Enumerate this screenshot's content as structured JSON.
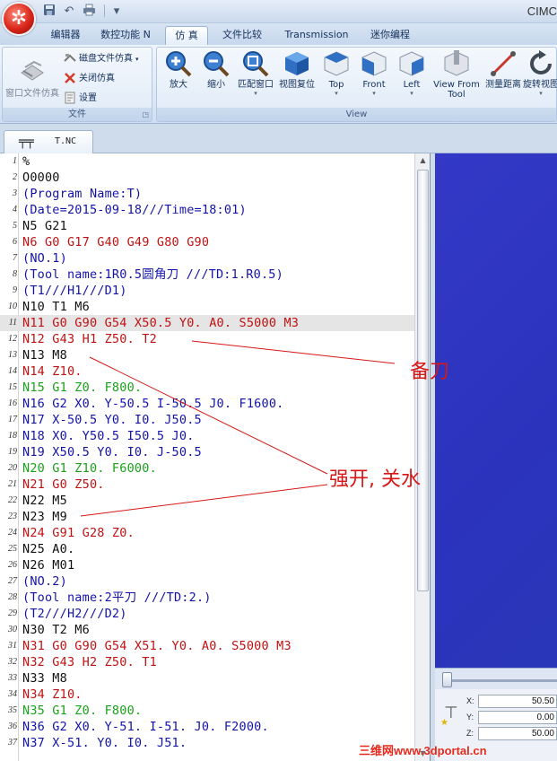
{
  "window": {
    "title": "CIMC"
  },
  "quick_access": [
    {
      "name": "save-icon",
      "glyph": "▪"
    },
    {
      "name": "undo-icon",
      "glyph": "↶"
    },
    {
      "name": "print-icon",
      "glyph": "▤"
    },
    {
      "name": "customize-icon",
      "glyph": "▾"
    }
  ],
  "ribbon_tabs": [
    {
      "label": "编辑器",
      "active": false
    },
    {
      "label": "数控功能 N",
      "active": false
    },
    {
      "label": "仿 真",
      "active": true
    },
    {
      "label": "文件比较",
      "active": false
    },
    {
      "label": "Transmission",
      "active": false
    },
    {
      "label": "迷你编程",
      "active": false
    }
  ],
  "ribbon": {
    "file_group": {
      "label": "文件",
      "big_button": "窗口文件仿真",
      "disk_sim": "磁盘文件仿真",
      "close_sim": "关闭仿真",
      "settings": "设置"
    },
    "view_group": {
      "label": "View",
      "buttons": [
        {
          "label": "放大",
          "icon": "zoom-in-icon",
          "dropdown": false
        },
        {
          "label": "缩小",
          "icon": "zoom-out-icon",
          "dropdown": false
        },
        {
          "label": "匹配窗口",
          "icon": "zoom-fit-icon",
          "dropdown": true
        },
        {
          "label": "视图复位",
          "icon": "view-reset-icon",
          "dropdown": false
        },
        {
          "label": "Top",
          "icon": "top-view-icon",
          "dropdown": true
        },
        {
          "label": "Front",
          "icon": "front-view-icon",
          "dropdown": true
        },
        {
          "label": "Left",
          "icon": "left-view-icon",
          "dropdown": true
        },
        {
          "label": "View From Tool",
          "icon": "view-from-tool-icon",
          "dropdown": false
        },
        {
          "label": "测量距离",
          "icon": "measure-distance-icon",
          "dropdown": false
        },
        {
          "label": "旋转视图",
          "icon": "rotate-view-icon",
          "dropdown": true
        }
      ]
    }
  },
  "document_tab": {
    "name": "T.NC"
  },
  "code_lines": [
    {
      "n": "1",
      "text": "%",
      "color": "black"
    },
    {
      "n": "2",
      "text": "O0000",
      "color": "black"
    },
    {
      "n": "3",
      "text": "(Program Name:T)",
      "color": "blue"
    },
    {
      "n": "4",
      "text": "(Date=2015-09-18///Time=18:01)",
      "color": "blue"
    },
    {
      "n": "5",
      "text": "N5 G21",
      "color": "black"
    },
    {
      "n": "6",
      "text": "N6 G0 G17 G40 G49 G80 G90",
      "color": "red"
    },
    {
      "n": "7",
      "text": "(NO.1)",
      "color": "blue"
    },
    {
      "n": "8",
      "text": "(Tool name:1R0.5圆角刀 ///TD:1.R0.5)",
      "color": "blue"
    },
    {
      "n": "9",
      "text": "(T1///H1///D1)",
      "color": "blue"
    },
    {
      "n": "10",
      "text": "N10 T1 M6",
      "color": "black"
    },
    {
      "n": "11",
      "text": "N11 G0 G90 G54 X50.5 Y0. A0. S5000 M3",
      "color": "red",
      "highlight": true
    },
    {
      "n": "12",
      "text": "N12 G43 H1 Z50. T2",
      "color": "red"
    },
    {
      "n": "13",
      "text": "N13 M8",
      "color": "black"
    },
    {
      "n": "14",
      "text": "N14 Z10.",
      "color": "red"
    },
    {
      "n": "15",
      "text": "N15 G1 Z0. F800.",
      "color": "green"
    },
    {
      "n": "16",
      "text": "N16 G2 X0. Y-50.5 I-50.5 J0. F1600.",
      "color": "blue"
    },
    {
      "n": "17",
      "text": "N17 X-50.5 Y0. I0. J50.5",
      "color": "blue"
    },
    {
      "n": "18",
      "text": "N18 X0. Y50.5 I50.5 J0.",
      "color": "blue"
    },
    {
      "n": "19",
      "text": "N19 X50.5 Y0. I0. J-50.5",
      "color": "blue"
    },
    {
      "n": "20",
      "text": "N20 G1 Z10. F6000.",
      "color": "green"
    },
    {
      "n": "21",
      "text": "N21 G0 Z50.",
      "color": "red"
    },
    {
      "n": "22",
      "text": "N22 M5",
      "color": "black"
    },
    {
      "n": "23",
      "text": "N23 M9",
      "color": "black"
    },
    {
      "n": "24",
      "text": "N24 G91 G28 Z0.",
      "color": "red"
    },
    {
      "n": "25",
      "text": "N25 A0.",
      "color": "black"
    },
    {
      "n": "26",
      "text": "N26 M01",
      "color": "black"
    },
    {
      "n": "27",
      "text": "(NO.2)",
      "color": "blue"
    },
    {
      "n": "28",
      "text": "(Tool name:2平刀 ///TD:2.)",
      "color": "blue"
    },
    {
      "n": "29",
      "text": "(T2///H2///D2)",
      "color": "blue"
    },
    {
      "n": "30",
      "text": "N30 T2 M6",
      "color": "black"
    },
    {
      "n": "31",
      "text": "N31 G0 G90 G54 X51. Y0. A0. S5000 M3",
      "color": "red"
    },
    {
      "n": "32",
      "text": "N32 G43 H2 Z50. T1",
      "color": "red"
    },
    {
      "n": "33",
      "text": "N33 M8",
      "color": "black"
    },
    {
      "n": "34",
      "text": "N34 Z10.",
      "color": "red"
    },
    {
      "n": "35",
      "text": "N35 G1 Z0. F800.",
      "color": "green"
    },
    {
      "n": "36",
      "text": "N36 G2 X0. Y-51. I-51. J0. F2000.",
      "color": "blue"
    },
    {
      "n": "37",
      "text": "N37 X-51. Y0. I0. J51.",
      "color": "blue"
    }
  ],
  "annotations": {
    "label_1": "备刀",
    "label_2": "强开, 关水"
  },
  "coordinates": {
    "x_label": "X:",
    "x_value": "50.50",
    "y_label": "Y:",
    "y_value": "0.00",
    "z_label": "Z:",
    "z_value": "50.00"
  },
  "watermark": "三维网www.3dportal.cn",
  "colors": {
    "black": "#111111",
    "red": "#c01212",
    "green": "#1aa11a",
    "blue": "#1313a8",
    "annotation": "#d71616",
    "viewport": "#2f36c2"
  }
}
